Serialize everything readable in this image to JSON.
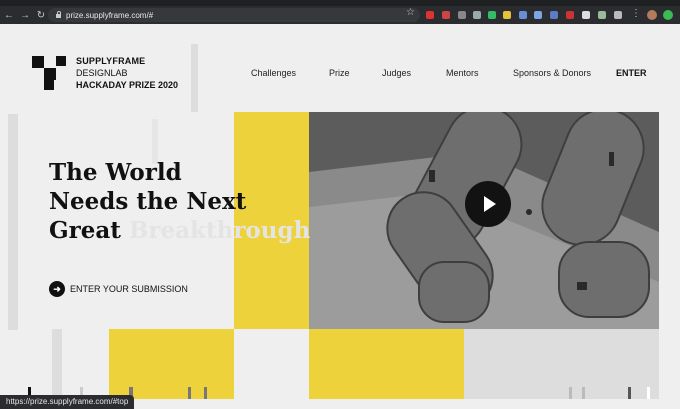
{
  "browser": {
    "url_text": "prize.supplyframe.com/#",
    "status_url": "https://prize.supplyframe.com/#top",
    "icons": [
      "back-icon",
      "forward-icon",
      "reload-icon",
      "lock-icon",
      "star-icon"
    ]
  },
  "brand": {
    "line1": "SUPPLYFRAME",
    "line2": "DESIGNLAB",
    "line3": "HACKADAY PRIZE 2020"
  },
  "nav": {
    "challenges": "Challenges",
    "prize": "Prize",
    "judges": "Judges",
    "mentors": "Mentors",
    "sponsors": "Sponsors & Donors",
    "enter": "ENTER"
  },
  "hero": {
    "line1": "The World",
    "line2": "Needs the Next",
    "line3_a": "Great",
    "line3_b": "Breakthrough"
  },
  "cta": {
    "label": "ENTER YOUR SUBMISSION",
    "icon": "arrow-right-icon"
  },
  "colors": {
    "accent_yellow": "#eed23b",
    "text_dark": "#111111",
    "chrome_dark": "#2b2c2f"
  }
}
